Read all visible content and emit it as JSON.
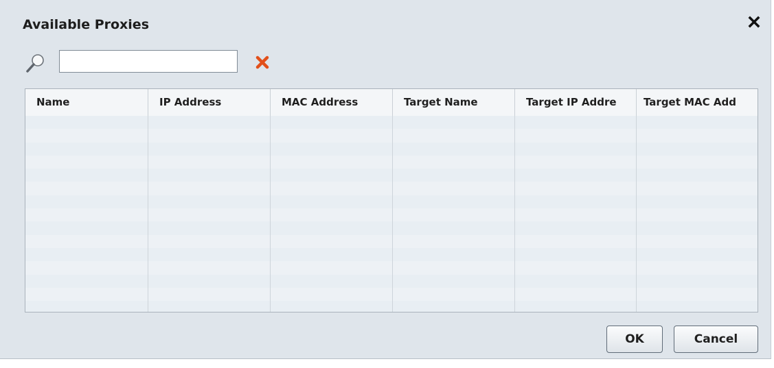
{
  "dialog": {
    "title": "Available Proxies",
    "close_icon": "close-icon"
  },
  "search": {
    "icon": "search-icon",
    "value": "",
    "placeholder": "",
    "clear_icon": "clear-icon",
    "clear_color": "#e2501b"
  },
  "table": {
    "columns": [
      {
        "label": "Name"
      },
      {
        "label": "IP Address"
      },
      {
        "label": "MAC Address"
      },
      {
        "label": "Target Name"
      },
      {
        "label": "Target IP Addre"
      },
      {
        "label": "Target MAC Add"
      }
    ],
    "rows": []
  },
  "buttons": {
    "ok_label": "OK",
    "cancel_label": "Cancel"
  }
}
